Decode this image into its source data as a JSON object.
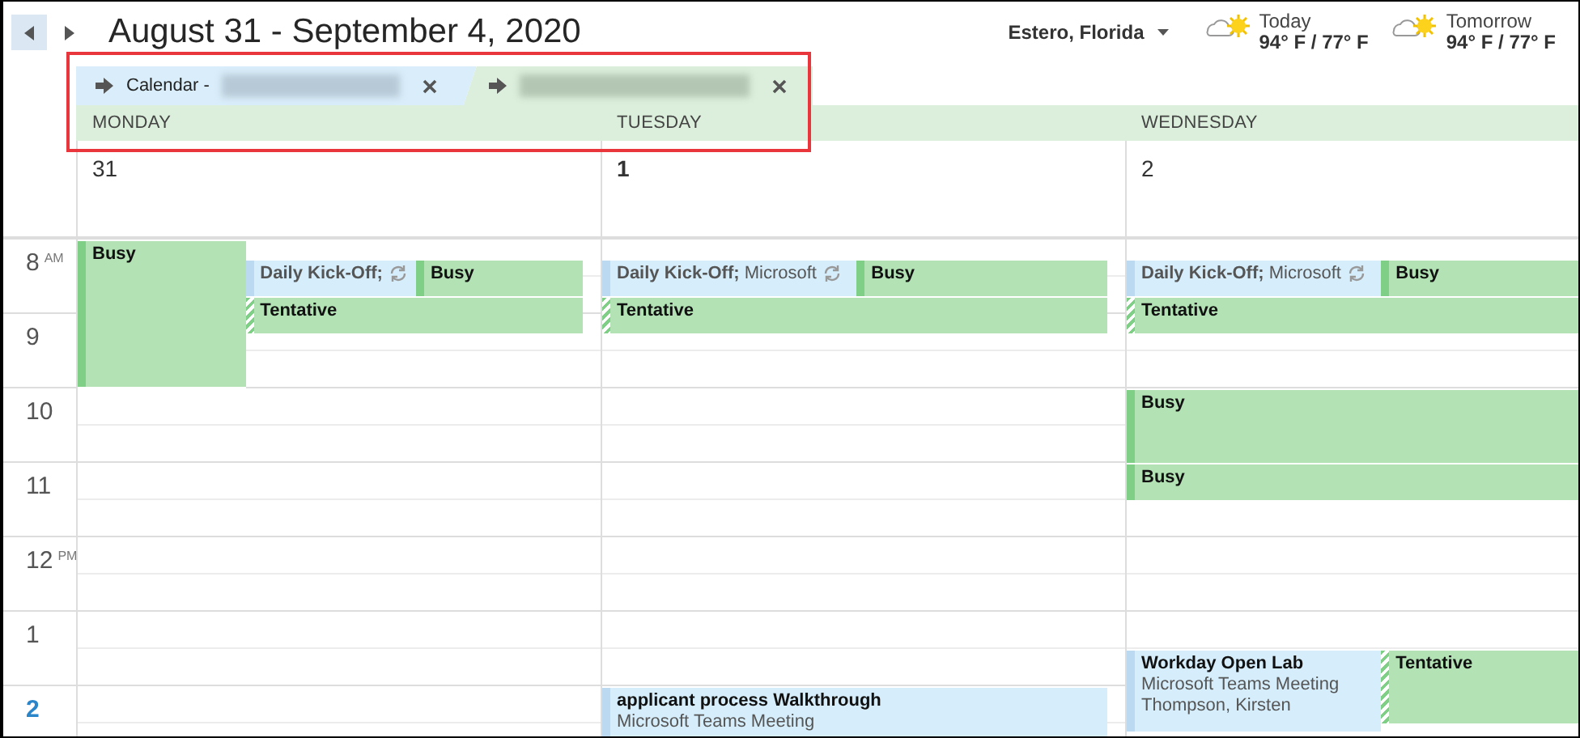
{
  "header": {
    "title": "August 31 - September 4, 2020",
    "location": "Estero, Florida",
    "weather": [
      {
        "day": "Today",
        "temps": "94° F / 77° F"
      },
      {
        "day": "Tomorrow",
        "temps": "94° F / 77° F"
      }
    ]
  },
  "calendar_tabs": [
    {
      "label": "Calendar -",
      "name_blurred": true,
      "color": "#d9eefa"
    },
    {
      "name_blurred": true,
      "color": "#dcefdc"
    }
  ],
  "tabs_highlighted": true,
  "time_slots": [
    {
      "label": "8",
      "suffix": "AM",
      "current": false
    },
    {
      "label": "9",
      "current": false
    },
    {
      "label": "10",
      "current": false
    },
    {
      "label": "11",
      "current": false
    },
    {
      "label": "12",
      "suffix": "PM",
      "current": false
    },
    {
      "label": "1",
      "current": false
    },
    {
      "label": "2",
      "current": true
    }
  ],
  "days": [
    {
      "name": "MONDAY",
      "date": "31",
      "month_start": false,
      "events": [
        {
          "kind": "busy",
          "title": "Busy"
        },
        {
          "kind": "meeting",
          "title": "Daily Kick-Off;",
          "recurring": true
        },
        {
          "kind": "busy",
          "title": "Busy"
        },
        {
          "kind": "tentative",
          "title": "Tentative"
        }
      ]
    },
    {
      "name": "TUESDAY",
      "date": "1",
      "month_start": true,
      "events": [
        {
          "kind": "meeting",
          "title": "Daily Kick-Off;",
          "subtitle": "Microsoft",
          "recurring": true
        },
        {
          "kind": "busy",
          "title": "Busy"
        },
        {
          "kind": "tentative",
          "title": "Tentative"
        },
        {
          "kind": "meeting",
          "title": "applicant process Walkthrough",
          "subtitle": "Microsoft Teams Meeting",
          "recurring": false
        }
      ]
    },
    {
      "name": "WEDNESDAY",
      "date": "2",
      "month_start": false,
      "events": [
        {
          "kind": "meeting",
          "title": "Daily Kick-Off;",
          "subtitle": "Microsoft",
          "recurring": true
        },
        {
          "kind": "busy",
          "title": "Busy"
        },
        {
          "kind": "tentative",
          "title": "Tentative"
        },
        {
          "kind": "busy",
          "title": "Busy"
        },
        {
          "kind": "busy",
          "title": "Busy"
        },
        {
          "kind": "meeting",
          "title": "Workday Open Lab",
          "subtitle": "Microsoft Teams Meeting",
          "organizer": "Thompson, Kirsten",
          "recurring": false
        },
        {
          "kind": "tentative",
          "title": "Tentative"
        }
      ]
    }
  ]
}
